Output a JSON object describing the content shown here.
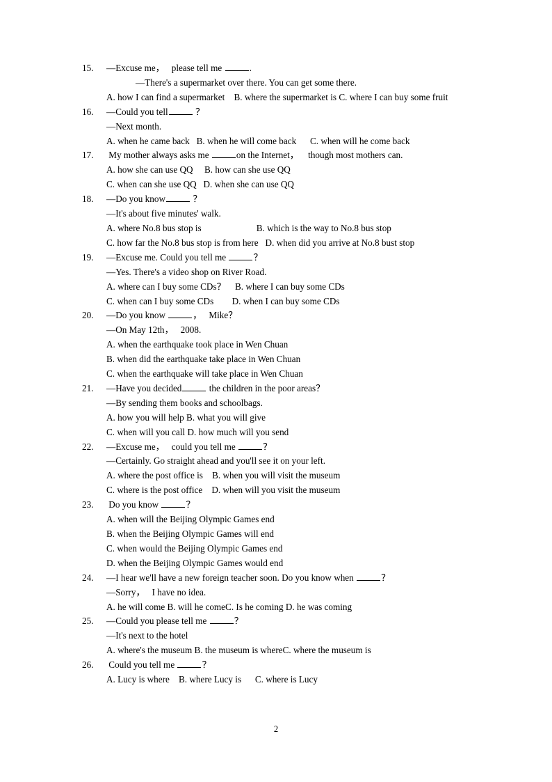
{
  "document": {
    "page_number": "2",
    "questions": [
      {
        "number": "15.",
        "stem_prefix": "—",
        "stem_before": "Excuse me，   please tell me ",
        "blank": "b-md",
        "stem_after": ".",
        "reply_prefix": "—",
        "reply": "There's a supermarket over there. You can get some there.",
        "reply_indent": "deep",
        "option_lines": [
          "A. how I can find a supermarket    B. where the supermarket is C. where I can buy some fruit"
        ]
      },
      {
        "number": "16.",
        "stem_prefix": "—",
        "stem_before": "Could you tell",
        "blank": "b-md",
        "stem_after": " ？",
        "reply_prefix": "—",
        "reply": "Next month.",
        "reply_indent": "",
        "option_lines": [
          "A. when he came back   B. when he will come back      C. when will he come back"
        ]
      },
      {
        "number": "17.",
        "stem_prefix": "",
        "stem_before": " My mother always asks me ",
        "blank": "b-md",
        "stem_after": "on the Internet，    though most mothers can.",
        "reply_prefix": "",
        "reply": "",
        "reply_indent": "",
        "option_lines": [
          "A. how she can use QQ     B. how can she use QQ",
          "C. when can she use QQ   D. when she can use QQ"
        ]
      },
      {
        "number": "18.",
        "stem_prefix": "—",
        "stem_before": "Do you know",
        "blank": "b-md",
        "stem_after": " ？",
        "reply_prefix": "—",
        "reply": "It's about five minutes' walk.",
        "reply_indent": "",
        "option_lines": [
          "A. where No.8 bus stop is                        B. which is the way to No.8 bus stop",
          "C. how far the No.8 bus stop is from here   D. when did you arrive at No.8 bust stop"
        ]
      },
      {
        "number": "19.",
        "stem_prefix": "—",
        "stem_before": "Excuse me. Could you tell me ",
        "blank": "b-md",
        "stem_after": "？",
        "reply_prefix": "—",
        "reply": "Yes. There's a video shop on River Road.",
        "reply_indent": "",
        "option_lines": [
          "A. where can I buy some CDs？    B. where I can buy some CDs",
          "C. when can I buy some CDs        D. when I can buy some CDs"
        ]
      },
      {
        "number": "20.",
        "stem_prefix": "—",
        "stem_before": "Do you know ",
        "blank": "b-md",
        "stem_after": "，   Mike？",
        "reply_prefix": "—",
        "reply": "On May 12th，   2008.",
        "reply_indent": "",
        "option_lines": [
          "A. when the earthquake took place in Wen Chuan",
          "B. when did the earthquake take place in Wen Chuan",
          "C. when the earthquake will take place in Wen Chuan"
        ]
      },
      {
        "number": "21.",
        "stem_prefix": "—",
        "stem_before": "Have you decided",
        "blank": "b-md",
        "stem_after": " the children in the poor areas？",
        "reply_prefix": "—",
        "reply": "By sending them books and schoolbags.",
        "reply_indent": "",
        "option_lines": [
          "A. how you will help B. what you will give",
          "C. when will you call D. how much will you send"
        ]
      },
      {
        "number": "22.",
        "stem_prefix": "—",
        "stem_before": "Excuse me，   could you tell me ",
        "blank": "b-md",
        "stem_after": "？",
        "reply_prefix": "—",
        "reply": "Certainly. Go straight ahead and you'll see it on your left.",
        "reply_indent": "",
        "option_lines": [
          "A. where the post office is    B. when you will visit the museum",
          "C. where is the post office    D. when will you visit the museum"
        ]
      },
      {
        "number": "23.",
        "stem_prefix": "",
        "stem_before": " Do you know ",
        "blank": "b-md",
        "stem_after": "？",
        "reply_prefix": "",
        "reply": "",
        "reply_indent": "",
        "option_lines": [
          "A. when will the Beijing Olympic Games end",
          "B. when the Beijing Olympic Games will end",
          "C. when would the Beijing Olympic Games end",
          "D. when the Beijing Olympic Games would end"
        ]
      },
      {
        "number": "24.",
        "stem_prefix": "—",
        "stem_before": "I hear we'll have a new foreign teacher soon. Do you know when ",
        "blank": "b-md",
        "stem_after": "？",
        "reply_prefix": "—",
        "reply": "Sorry，   I have no idea.",
        "reply_indent": "",
        "option_lines": [
          "A. he will come B. will he comeC. Is he coming D. he was coming"
        ]
      },
      {
        "number": "25.",
        "stem_prefix": "—",
        "stem_before": "Could you please tell me ",
        "blank": "b-md",
        "stem_after": "？",
        "reply_prefix": "—",
        "reply": "It's next to the hotel",
        "reply_indent": "",
        "option_lines": [
          "A. where's the museum B. the museum is whereC. where the museum is"
        ]
      },
      {
        "number": "26.",
        "stem_prefix": "",
        "stem_before": " Could you tell me ",
        "blank": "b-md",
        "stem_after": "？",
        "reply_prefix": "",
        "reply": "",
        "reply_indent": "",
        "option_lines": [
          "A. Lucy is where    B. where Lucy is      C. where is Lucy"
        ]
      }
    ]
  }
}
